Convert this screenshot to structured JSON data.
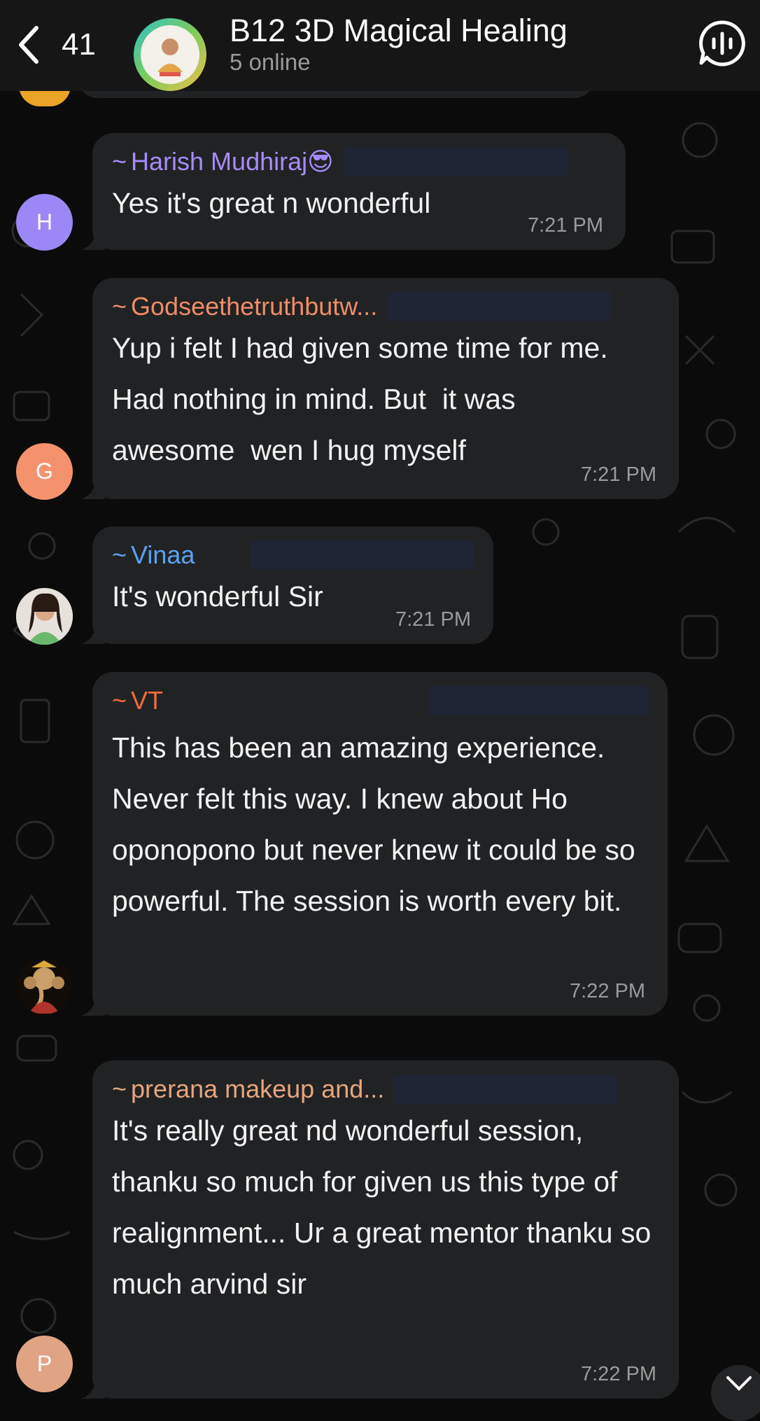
{
  "header": {
    "back_count": "41",
    "title": "B12 3D Magical Healing",
    "status": "5 online",
    "icons": {
      "back": "chevron-left-icon",
      "call": "voice-chat-icon"
    }
  },
  "messages": [
    {
      "sender": "Harish Mudhiraj",
      "sender_emoji": "😎",
      "sender_color": "#a78bfa",
      "text": "Yes it's great n wonderful",
      "time": "7:21 PM",
      "avatar_letter": "H",
      "avatar_color": "#9b87f5"
    },
    {
      "sender": "Godseethetruthbutw...",
      "sender_color": "#f08c67",
      "text": "Yup i felt I had given some time for me. Had nothing in mind. But  it was awesome  wen I hug myself",
      "time": "7:21 PM",
      "avatar_letter": "G",
      "avatar_color": "#f4926e"
    },
    {
      "sender": "Vinaa",
      "sender_color": "#5aa2ef",
      "text": "It's wonderful Sir",
      "time": "7:21 PM"
    },
    {
      "sender": "VT",
      "sender_color": "#f06a3c",
      "text": "This has been an amazing experience. Never felt this way. I knew about Ho oponopono but never knew it could be so powerful. The session is worth every bit.",
      "time": "7:22 PM"
    },
    {
      "sender": "prerana makeup and...",
      "sender_color": "#e7a57e",
      "text": "It's really great nd wonderful session, thanku so much for given us this type of realignment... Ur a great mentor thanku so much arvind sir",
      "time": "7:22 PM",
      "avatar_letter": "P",
      "avatar_color": "#e0a384"
    }
  ],
  "scroll_icon": "chevron-down-icon"
}
